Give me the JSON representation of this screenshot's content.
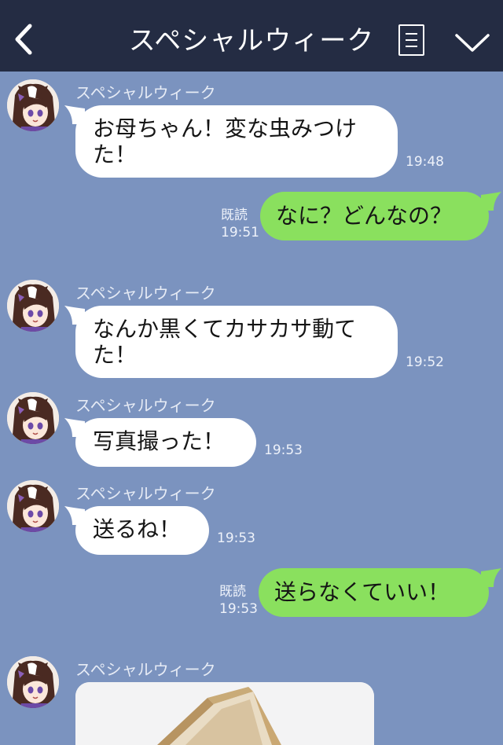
{
  "header": {
    "title": "スペシャルウィーク",
    "back_icon": "chevron-left-icon",
    "menu_icon": "menu-icon",
    "collapse_icon": "chevron-down-icon"
  },
  "colors": {
    "header_bg": "#242c43",
    "chat_bg": "#7b93bf",
    "incoming_bubble": "#ffffff",
    "outgoing_bubble": "#8ae05e"
  },
  "messages": [
    {
      "sender": "スペシャルウィーク",
      "text": "お母ちゃん！変な虫みつけた！",
      "time": "19:48"
    },
    {
      "read": "既読",
      "text": "なに？どんなの？",
      "time": "19:51"
    },
    {
      "sender": "スペシャルウィーク",
      "text": "なんか黒くてカサカサ動てた！",
      "time": "19:52"
    },
    {
      "sender": "スペシャルウィーク",
      "text": "写真撮った！",
      "time": "19:53"
    },
    {
      "sender": "スペシャルウィーク",
      "text": "送るね！",
      "time": "19:53"
    },
    {
      "read": "既読",
      "text": "送らなくていい！",
      "time": "19:53"
    },
    {
      "sender": "スペシャルウィーク"
    }
  ]
}
